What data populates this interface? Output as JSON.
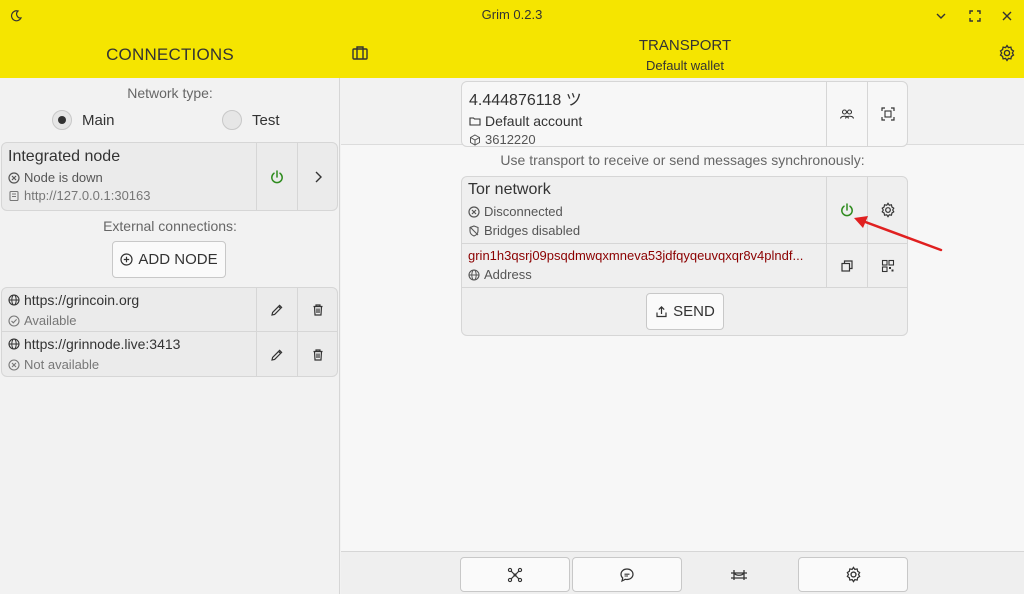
{
  "window": {
    "title": "Grim 0.2.3",
    "icons": [
      "moon-icon",
      "chevron-down-icon",
      "fullscreen-icon",
      "close-icon"
    ]
  },
  "header": {
    "connections_title": "CONNECTIONS",
    "transport_title": "TRANSPORT",
    "wallet_name": "Default wallet",
    "left_icon": "wallet-icon",
    "right_icon": "gear-icon"
  },
  "connections": {
    "network_type_label": "Network type:",
    "network_options": [
      {
        "label": "Main",
        "selected": true
      },
      {
        "label": "Test",
        "selected": false
      }
    ],
    "integrated_node": {
      "title": "Integrated node",
      "status": "Node is down",
      "address": "http://127.0.0.1:30163"
    },
    "external_label": "External connections:",
    "add_node_label": "ADD NODE",
    "external_nodes": [
      {
        "url": "https://grincoin.org",
        "status": "Available"
      },
      {
        "url": "https://grinnode.live:3413",
        "status": "Not available"
      }
    ]
  },
  "transport": {
    "balance": "4.444876118 ツ",
    "account": "Default account",
    "height": "3612220",
    "info_text": "Use transport to receive or send messages synchronously:",
    "tor": {
      "title": "Tor network",
      "status": "Disconnected",
      "bridges": "Bridges disabled",
      "address_value": "grin1h3qsrj09psqdmwqxmneva53jdfqyqeuvqxqr8v4plndf...",
      "address_label": "Address"
    },
    "send_label": "SEND"
  },
  "tabs": [
    {
      "icon": "network-icon",
      "active": false
    },
    {
      "icon": "chat-icon",
      "active": false
    },
    {
      "icon": "bridge-icon",
      "active": true
    },
    {
      "icon": "settings-icon",
      "active": false
    }
  ],
  "colors": {
    "accent_yellow": "#f5e500",
    "power_green": "#2e8b1e",
    "address_red": "#8b0000",
    "arrow_red": "#e02020"
  }
}
